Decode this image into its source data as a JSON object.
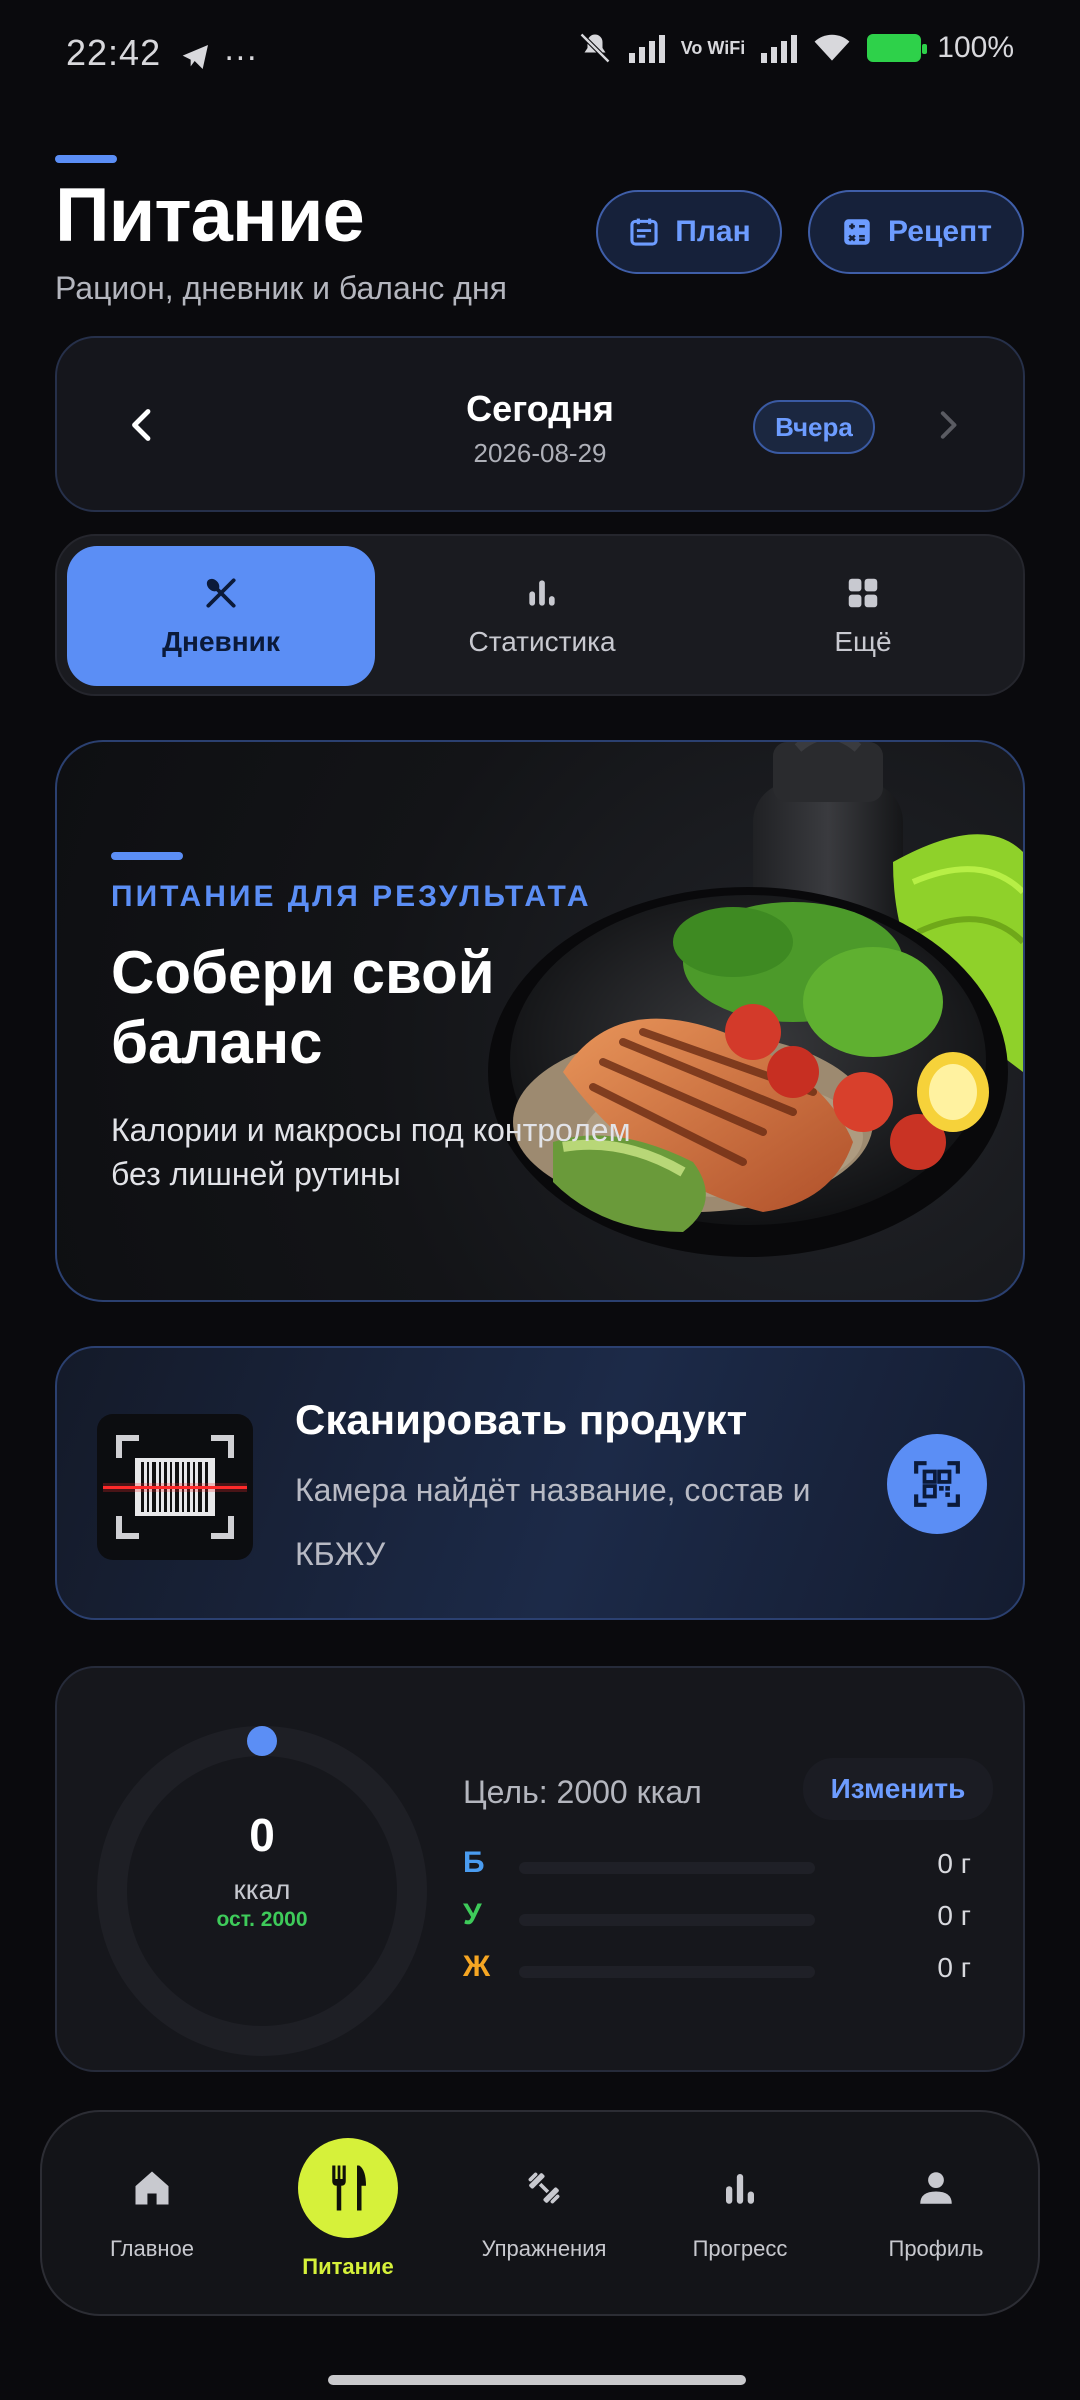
{
  "status_bar": {
    "time": "22:42",
    "network_label": "Vo WiFi",
    "battery": "100%"
  },
  "header": {
    "title": "Питание",
    "subtitle": "Рацион, дневник и баланс дня",
    "plan_label": "План",
    "recipe_label": "Рецепт"
  },
  "date_nav": {
    "title": "Сегодня",
    "date": "2026-08-29",
    "yesterday_label": "Вчера"
  },
  "tabs": [
    {
      "label": "Дневник",
      "active": true
    },
    {
      "label": "Статистика",
      "active": false
    },
    {
      "label": "Ещё",
      "active": false
    }
  ],
  "hero": {
    "kicker": "ПИТАНИЕ ДЛЯ РЕЗУЛЬТАТА",
    "title": "Собери свой баланс",
    "text": "Калории и макросы под контролем без лишней рутины"
  },
  "scan": {
    "title": "Сканировать продукт",
    "text": "Камера найдёт название, состав и КБЖУ"
  },
  "calories": {
    "value": "0",
    "unit": "ккал",
    "remaining": "ост. 2000",
    "goal": "Цель: 2000 ккал",
    "edit_label": "Изменить",
    "progress": 0,
    "macros": [
      {
        "letter": "Б",
        "value": "0 г",
        "color": "#4a9cf0",
        "progress": 0
      },
      {
        "letter": "У",
        "value": "0 г",
        "color": "#3ecb5a",
        "progress": 0
      },
      {
        "letter": "Ж",
        "value": "0 г",
        "color": "#f5a623",
        "progress": 0
      }
    ]
  },
  "bottom_nav": [
    {
      "label": "Главное",
      "icon": "home-icon",
      "active": false
    },
    {
      "label": "Питание",
      "icon": "fork-knife-icon",
      "active": true
    },
    {
      "label": "Упражнения",
      "icon": "dumbbell-icon",
      "active": false
    },
    {
      "label": "Прогресс",
      "icon": "bar-chart-icon",
      "active": false
    },
    {
      "label": "Профиль",
      "icon": "person-icon",
      "active": false
    }
  ],
  "colors": {
    "accent": "#5b8ef5",
    "lime": "#d6f13a",
    "background": "#0a0a0d",
    "ok": "#3ecb5a"
  }
}
